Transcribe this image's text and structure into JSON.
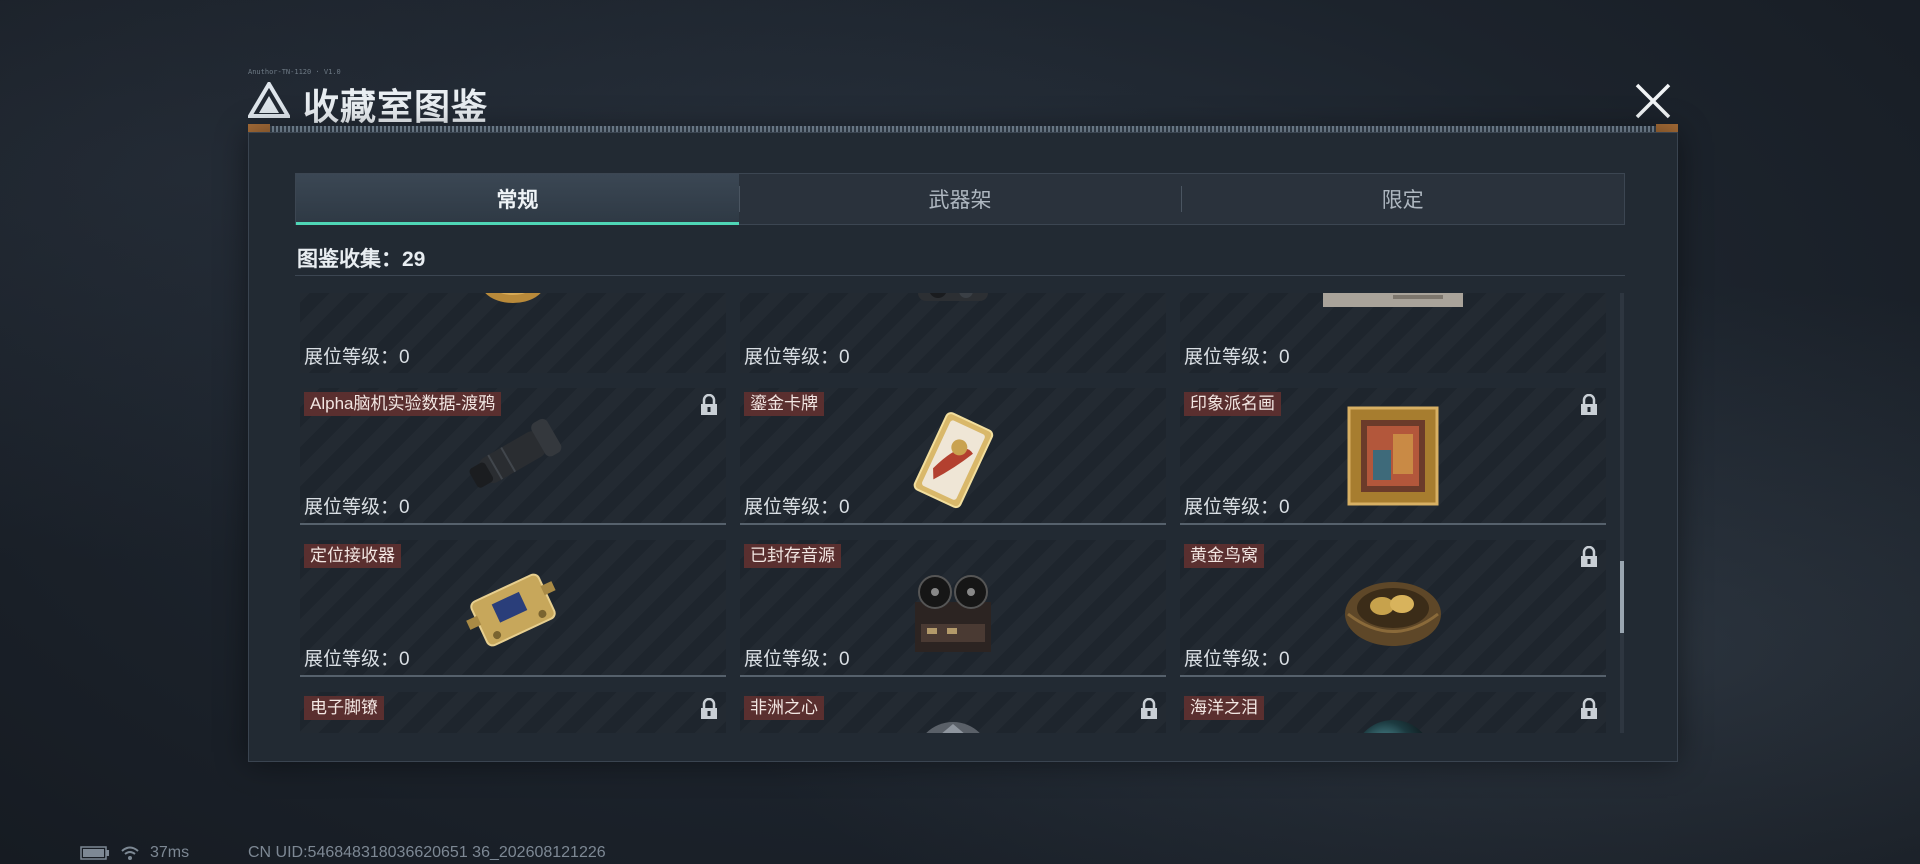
{
  "header": {
    "title": "收藏室图鉴",
    "tiny_text": "Anuthor-TN-1120 · V1.0"
  },
  "tabs": [
    {
      "label": "常规",
      "active": true
    },
    {
      "label": "武器架",
      "active": false
    },
    {
      "label": "限定",
      "active": false
    }
  ],
  "collection": {
    "label": "图鉴收集：29"
  },
  "items": [
    {
      "name": "",
      "locked": false,
      "level": "展位等级：0",
      "art": "gold-disc"
    },
    {
      "name": "",
      "locked": false,
      "level": "展位等级：0",
      "art": "dark-device"
    },
    {
      "name": "",
      "locked": false,
      "level": "展位等级：0",
      "art": "paper"
    },
    {
      "name": "Alpha脑机实验数据-渡鸦",
      "locked": true,
      "level": "展位等级：0",
      "art": "scope"
    },
    {
      "name": "鎏金卡牌",
      "locked": false,
      "level": "展位等级：0",
      "art": "card"
    },
    {
      "name": "印象派名画",
      "locked": true,
      "level": "展位等级：0",
      "art": "painting"
    },
    {
      "name": "定位接收器",
      "locked": false,
      "level": "展位等级：0",
      "art": "receiver"
    },
    {
      "name": "已封存音源",
      "locked": false,
      "level": "展位等级：0",
      "art": "reel"
    },
    {
      "name": "黄金鸟窝",
      "locked": true,
      "level": "展位等级：0",
      "art": "nest"
    },
    {
      "name": "电子脚镣",
      "locked": true,
      "level": "",
      "art": "shackle"
    },
    {
      "name": "非洲之心",
      "locked": true,
      "level": "",
      "art": "diamond"
    },
    {
      "name": "海洋之泪",
      "locked": true,
      "level": "",
      "art": "pearl"
    }
  ],
  "status_bar": {
    "ping": "37ms",
    "uid": "CN UID:546848318036620651 36_202608121226"
  },
  "colors": {
    "accent": "#4fd6b6",
    "name_tag": "#5a2f2f",
    "panel": "#222a33"
  }
}
